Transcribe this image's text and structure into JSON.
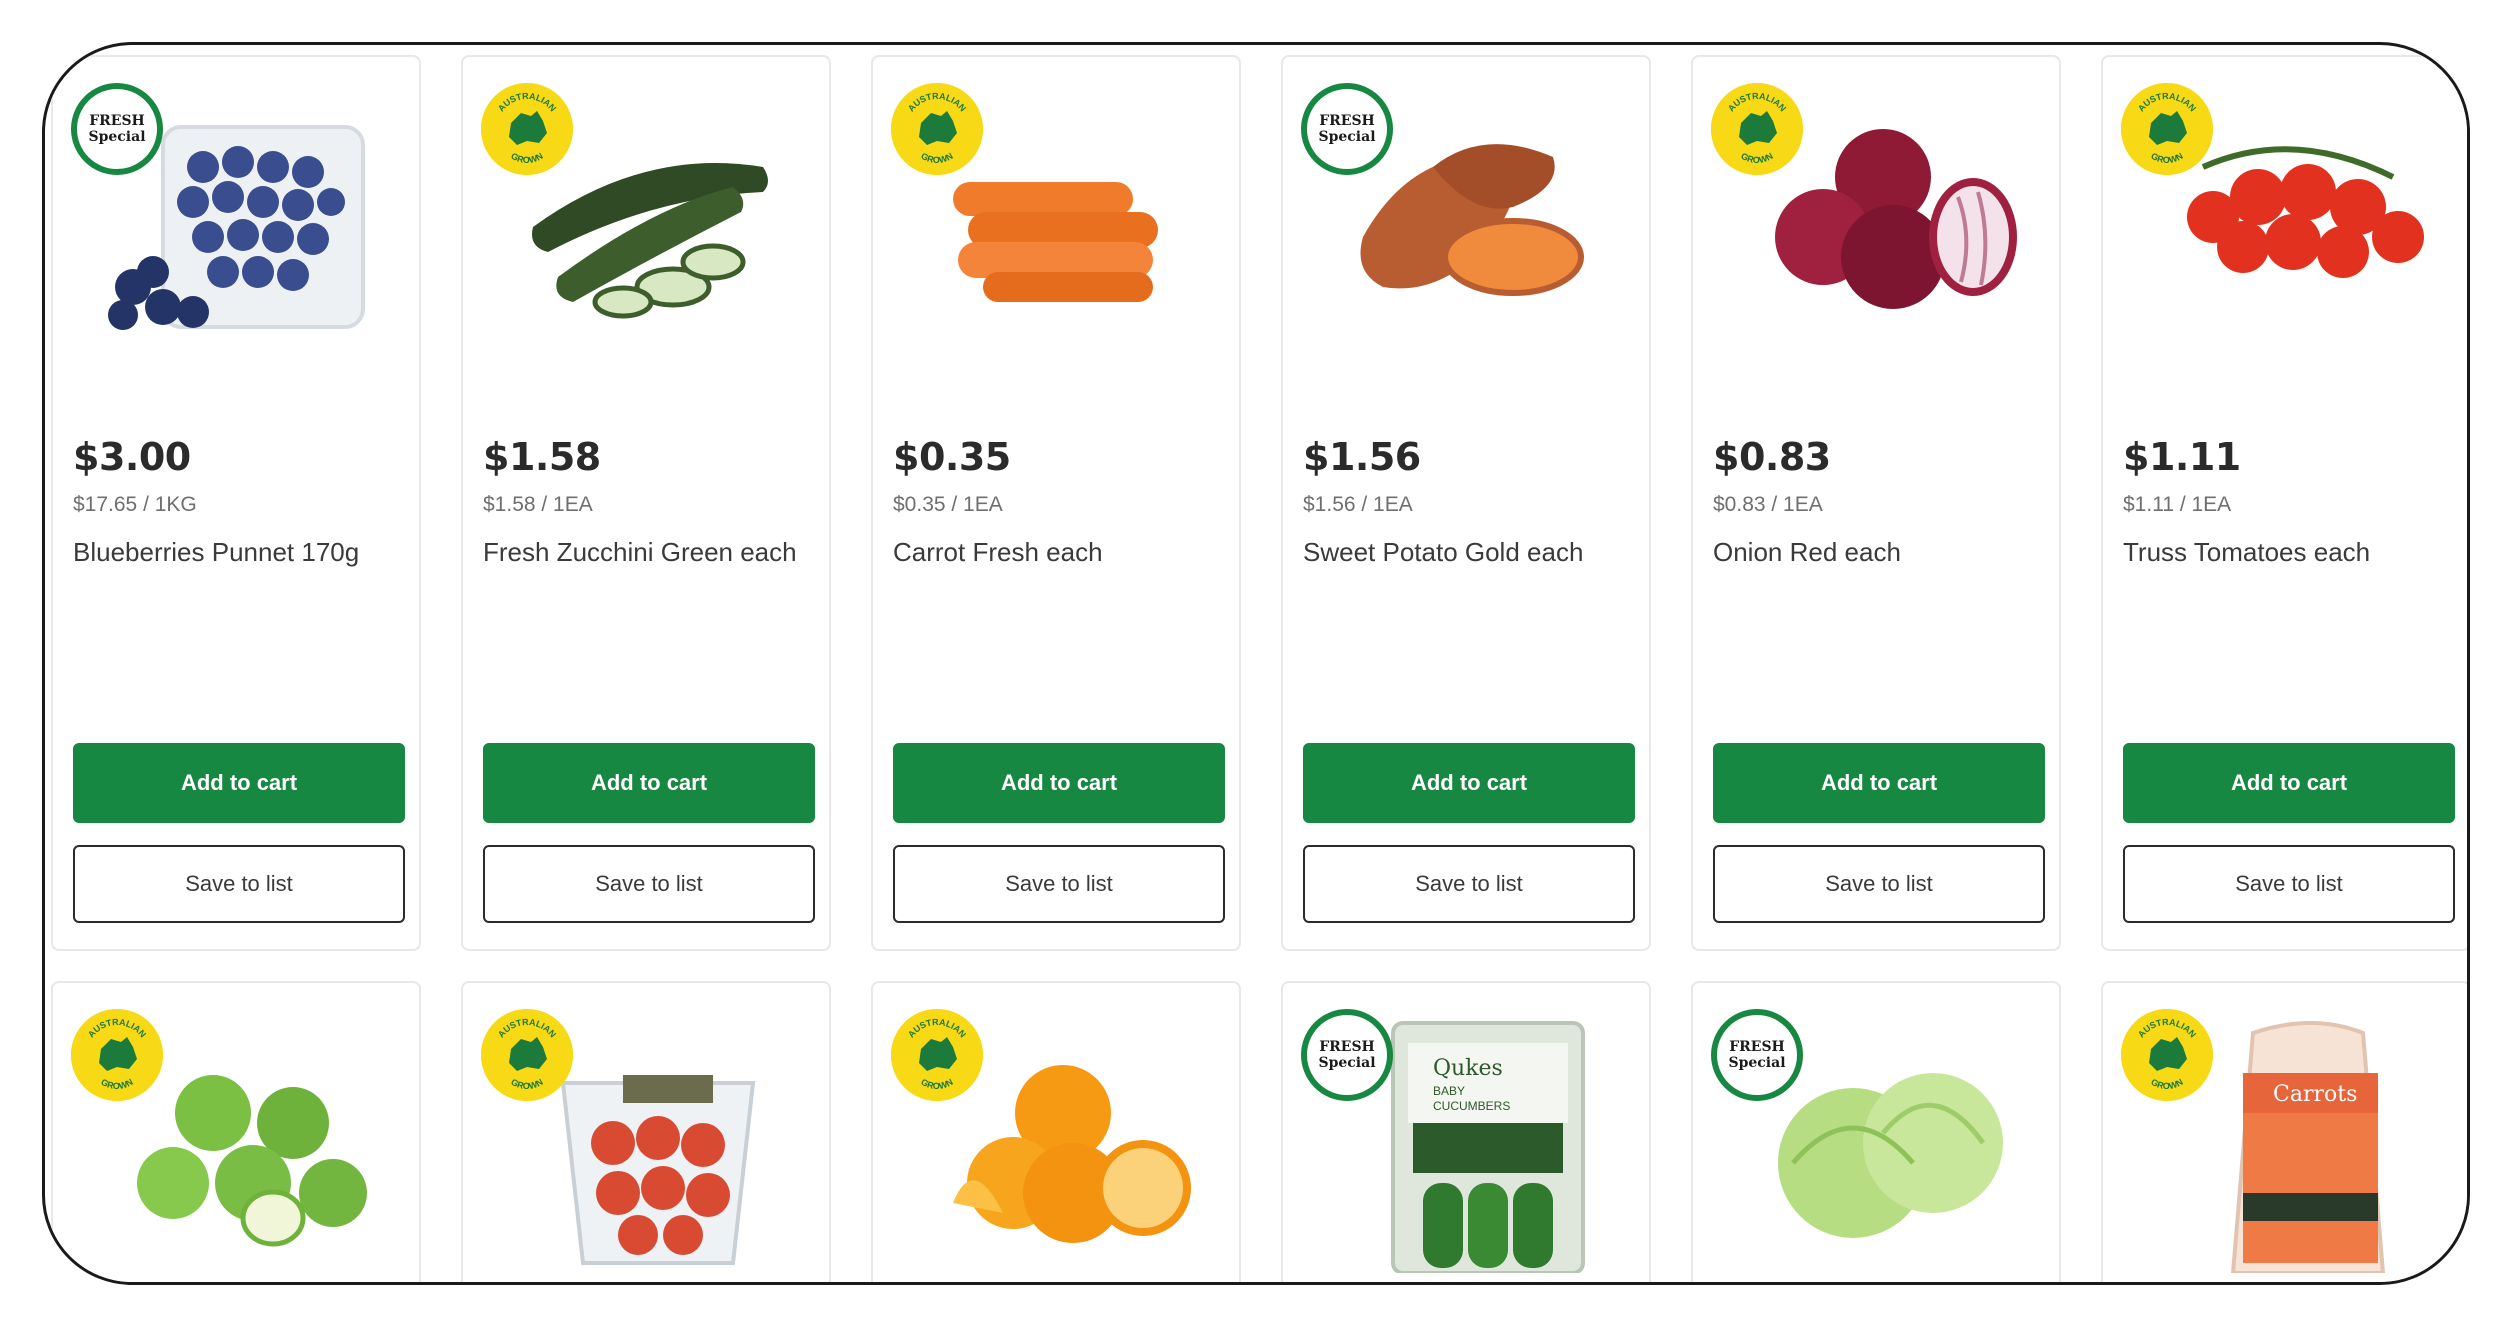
{
  "products": [
    {
      "badge": "fresh",
      "badge_text": [
        "FRESH",
        "Special"
      ],
      "price": "$3.00",
      "unit": "$17.65 / 1KG",
      "name": "Blueberries Punnet 170g",
      "add_label": "Add to cart",
      "save_label": "Save to list",
      "image": "blueberries-punnet-image"
    },
    {
      "badge": "aus",
      "badge_text": [
        "AUSTRALIAN",
        "GROWN"
      ],
      "price": "$1.58",
      "unit": "$1.58 / 1EA",
      "name": "Fresh Zucchini Green each",
      "add_label": "Add to cart",
      "save_label": "Save to list",
      "image": "zucchini-image"
    },
    {
      "badge": "aus",
      "badge_text": [
        "AUSTRALIAN",
        "GROWN"
      ],
      "price": "$0.35",
      "unit": "$0.35 / 1EA",
      "name": "Carrot Fresh each",
      "add_label": "Add to cart",
      "save_label": "Save to list",
      "image": "carrots-image"
    },
    {
      "badge": "fresh",
      "badge_text": [
        "FRESH",
        "Special"
      ],
      "price": "$1.56",
      "unit": "$1.56 / 1EA",
      "name": "Sweet Potato Gold each",
      "add_label": "Add to cart",
      "save_label": "Save to list",
      "image": "sweet-potato-image"
    },
    {
      "badge": "aus",
      "badge_text": [
        "AUSTRALIAN",
        "GROWN"
      ],
      "price": "$0.83",
      "unit": "$0.83 / 1EA",
      "name": "Onion Red each",
      "add_label": "Add to cart",
      "save_label": "Save to list",
      "image": "red-onion-image"
    },
    {
      "badge": "aus",
      "badge_text": [
        "AUSTRALIAN",
        "GROWN"
      ],
      "price": "$1.11",
      "unit": "$1.11 / 1EA",
      "name": "Truss Tomatoes each",
      "add_label": "Add to cart",
      "save_label": "Save to list",
      "image": "truss-tomatoes-image"
    }
  ],
  "products_row2": [
    {
      "badge": "aus",
      "badge_text": [
        "AUSTRALIAN",
        "GROWN"
      ],
      "image": "green-apples-image"
    },
    {
      "badge": "aus",
      "badge_text": [
        "AUSTRALIAN",
        "GROWN"
      ],
      "image": "cherry-tomatoes-punnet-image"
    },
    {
      "badge": "aus",
      "badge_text": [
        "AUSTRALIAN",
        "GROWN"
      ],
      "image": "oranges-image"
    },
    {
      "badge": "fresh",
      "badge_text": [
        "FRESH",
        "Special"
      ],
      "image": "qukes-cucumbers-image",
      "package_text": [
        "Qukes",
        "BABY",
        "CUCUMBERS"
      ]
    },
    {
      "badge": "fresh",
      "badge_text": [
        "FRESH",
        "Special"
      ],
      "image": "iceberg-lettuce-image"
    },
    {
      "badge": "aus",
      "badge_text": [
        "AUSTRALIAN",
        "GROWN"
      ],
      "image": "carrots-bag-image",
      "package_text": [
        "Carrots"
      ]
    }
  ],
  "colors": {
    "brand_green": "#178841",
    "badge_yellow": "#f7d916"
  }
}
